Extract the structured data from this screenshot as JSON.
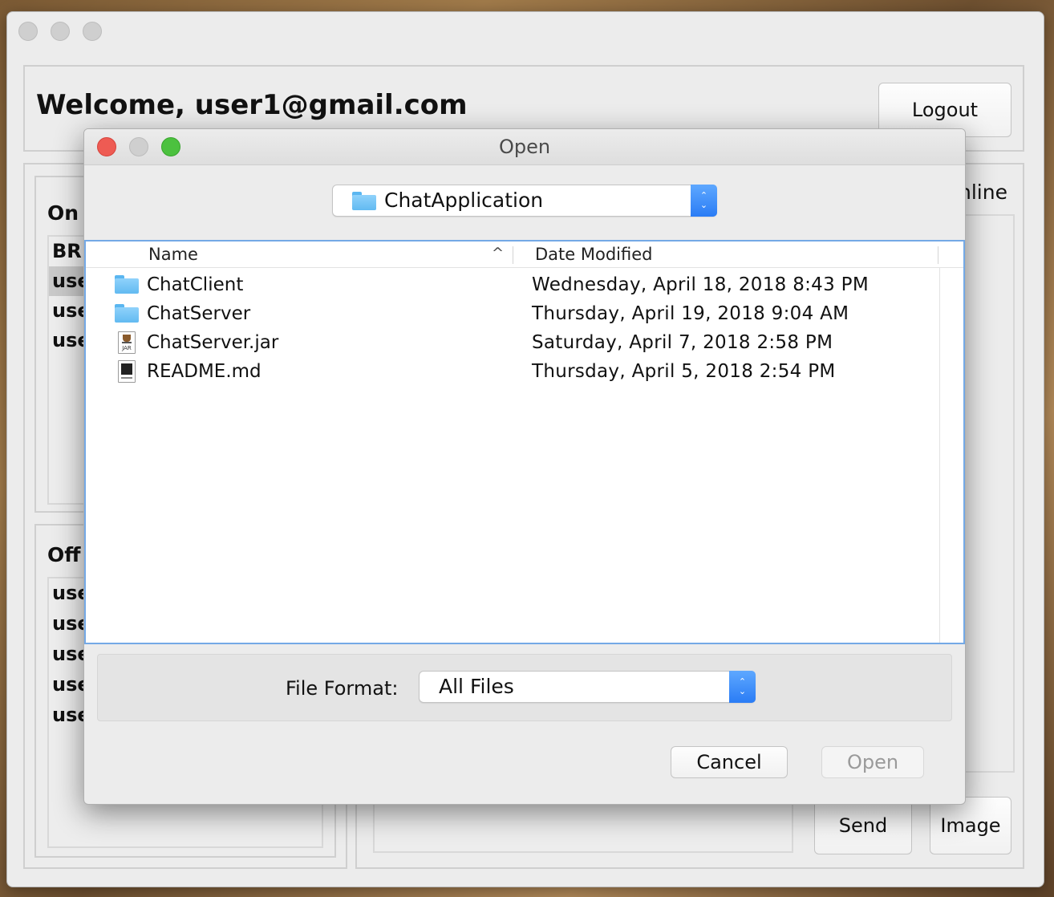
{
  "main_window": {
    "welcome_text": "Welcome,  user1@gmail.com",
    "logout_label": "Logout",
    "online_panel_title": "On",
    "online_right_label": "nline",
    "online_users": [
      "BR",
      "use",
      "use",
      "use"
    ],
    "offline_panel_title": "Off",
    "offline_users": [
      "use",
      "use",
      "use",
      "use",
      "use"
    ],
    "send_label": "Send",
    "image_label": "Image"
  },
  "dialog": {
    "title": "Open",
    "location": "ChatApplication",
    "columns": {
      "name": "Name",
      "date": "Date Modified",
      "sort_arrow": "^"
    },
    "files": [
      {
        "name": "ChatClient",
        "date": "Wednesday, April 18, 2018 8:43 PM",
        "icon": "folder-icon"
      },
      {
        "name": "ChatServer",
        "date": "Thursday, April 19, 2018 9:04 AM",
        "icon": "folder-icon"
      },
      {
        "name": "ChatServer.jar",
        "date": "Saturday, April 7, 2018 2:58 PM",
        "icon": "jar-file-icon"
      },
      {
        "name": "README.md",
        "date": "Thursday, April 5, 2018 2:54 PM",
        "icon": "markdown-file-icon"
      }
    ],
    "jar_badge": "JAR",
    "file_format_label": "File Format:",
    "file_format_value": "All Files",
    "cancel_label": "Cancel",
    "open_label": "Open"
  },
  "colors": {
    "close": "#ee5b53",
    "minimize": "#cfcfcf",
    "zoom": "#4cc13f",
    "accent": "#2a7cf5",
    "table_border": "#74a9e6"
  }
}
